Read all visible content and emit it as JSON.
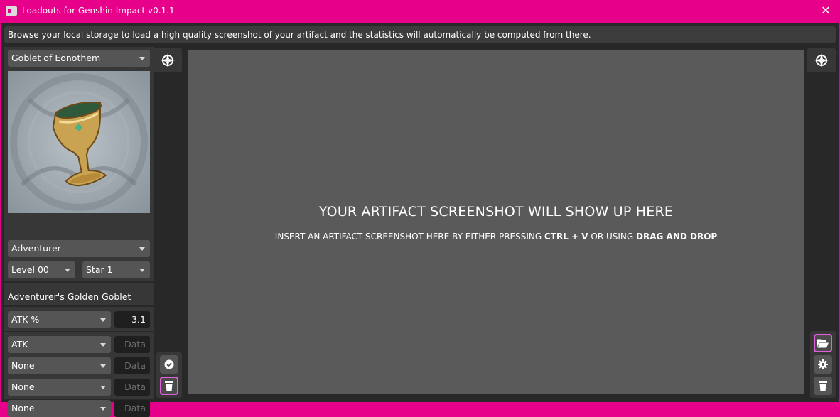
{
  "window": {
    "title": "Loadouts for Genshin Impact v0.1.1",
    "close_glyph": "✕"
  },
  "info": {
    "text": "Browse your local storage to load a high quality screenshot of your artifact and the statistics will automatically be computed from there."
  },
  "artifact": {
    "type_select": "Goblet of Eonothem",
    "image_icon": "golden-goblet-icon",
    "set_select": "Adventurer",
    "level_select": "Level 00",
    "rarity_select": "Star 1",
    "name": "Adventurer's Golden Goblet",
    "main_stat": {
      "name": "ATK %",
      "value": "3.1"
    },
    "substats": [
      {
        "name": "ATK",
        "placeholder": "Data"
      },
      {
        "name": "None",
        "placeholder": "Data"
      },
      {
        "name": "None",
        "placeholder": "Data"
      },
      {
        "name": "None",
        "placeholder": "Data"
      }
    ]
  },
  "main": {
    "heading": "YOUR ARTIFACT SCREENSHOT WILL SHOW UP HERE",
    "sub_prefix": "INSERT AN ARTIFACT SCREENSHOT HERE BY EITHER PRESSING ",
    "sub_key": "CTRL + V",
    "sub_middle": " OR USING ",
    "sub_method": "DRAG AND DROP"
  },
  "icons": {
    "left_nav": "compass-icon",
    "right_nav": "compass-icon",
    "confirm": "check-circle-icon",
    "clear_left": "trash-icon",
    "open": "folder-open-icon",
    "settings": "gear-icon",
    "clear_right": "trash-icon"
  },
  "colors": {
    "accent": "#e6008a",
    "active_border": "#e060d8",
    "canvas": "#5a5a5a",
    "panel": "#373737",
    "background": "#282828"
  }
}
